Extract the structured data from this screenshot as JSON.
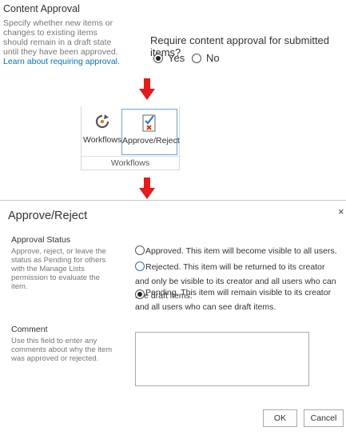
{
  "content_approval": {
    "title": "Content Approval",
    "description": "Specify whether new items or changes to existing items should remain in a draft state until they have been approved.",
    "link": "Learn about requiring approval.",
    "question": "Require content approval for submitted items?",
    "options": [
      {
        "label": "Yes",
        "checked": true
      },
      {
        "label": "No",
        "checked": false
      }
    ]
  },
  "ribbon": {
    "buttons": [
      {
        "label": "Workflows",
        "icon": "workflows-icon"
      },
      {
        "label": "Approve/Reject",
        "icon": "approve-reject-icon"
      }
    ],
    "group_label": "Workflows"
  },
  "dialog": {
    "title": "Approve/Reject",
    "close": "×",
    "approval_status": {
      "title": "Approval Status",
      "description": "Approve, reject, or leave the status as Pending for others with the Manage Lists permission to evaluate the item.",
      "options": [
        {
          "label": "Approved. This item will become visible to all users.",
          "checked": false
        },
        {
          "label": "Rejected. This item will be returned to its creator and only be visible to its creator and all users who can see draft items.",
          "checked": false
        },
        {
          "label": "Pending. This item will remain visible to its creator and all users who can see draft items.",
          "checked": true
        }
      ]
    },
    "comment": {
      "title": "Comment",
      "description": "Use this field to enter any comments about why the item was approved or rejected.",
      "value": ""
    },
    "ok_label": "OK",
    "cancel_label": "Cancel"
  },
  "colors": {
    "arrow": "#e41a1c",
    "link": "#0072c6",
    "highlight_border": "#6aa3d9"
  }
}
